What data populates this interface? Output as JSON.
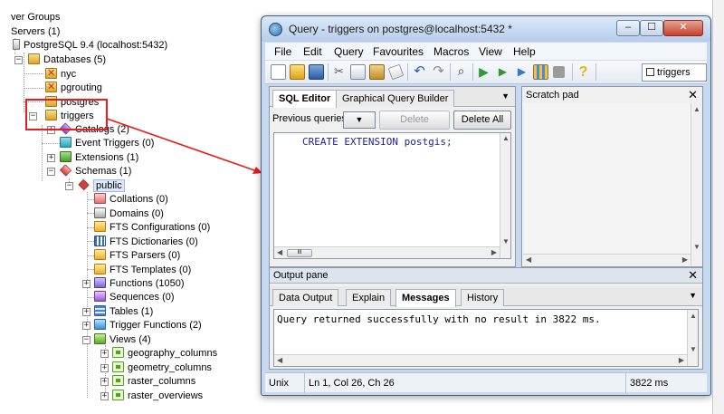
{
  "tree": {
    "items": [
      {
        "label": "ver Groups"
      },
      {
        "label": "Servers (1)"
      },
      {
        "label": "PostgreSQL 9.4 (localhost:5432)"
      },
      {
        "label": "Databases (5)"
      },
      {
        "label": "nyc"
      },
      {
        "label": "pgrouting"
      },
      {
        "label": "postgres"
      },
      {
        "label": "triggers"
      },
      {
        "label": "Catalogs (2)"
      },
      {
        "label": "Event Triggers (0)"
      },
      {
        "label": "Extensions (1)"
      },
      {
        "label": "Schemas (1)"
      },
      {
        "label": "public"
      },
      {
        "label": "Collations (0)"
      },
      {
        "label": "Domains (0)"
      },
      {
        "label": "FTS Configurations (0)"
      },
      {
        "label": "FTS Dictionaries (0)"
      },
      {
        "label": "FTS Parsers (0)"
      },
      {
        "label": "FTS Templates (0)"
      },
      {
        "label": "Functions (1050)"
      },
      {
        "label": "Sequences (0)"
      },
      {
        "label": "Tables (1)"
      },
      {
        "label": "Trigger Functions (2)"
      },
      {
        "label": "Views (4)"
      },
      {
        "label": "geography_columns"
      },
      {
        "label": "geometry_columns"
      },
      {
        "label": "raster_columns"
      },
      {
        "label": "raster_overviews"
      }
    ]
  },
  "window": {
    "title": "Query - triggers on postgres@localhost:5432 *",
    "controls": {
      "minimize": "‒",
      "maximize": "☐",
      "close": "✕"
    }
  },
  "menu": [
    "File",
    "Edit",
    "Query",
    "Favourites",
    "Macros",
    "View",
    "Help"
  ],
  "toolbar": {
    "db_combo": "triggers"
  },
  "editor": {
    "tabs": [
      "SQL Editor",
      "Graphical Query Builder"
    ],
    "active_tab": "SQL Editor",
    "previous_label": "Previous queries",
    "delete_label": "Delete",
    "delete_all_label": "Delete All",
    "sql": "CREATE EXTENSION postgis;",
    "scroll_thumb": "III"
  },
  "scratch": {
    "title": "Scratch pad",
    "close": "✕"
  },
  "output": {
    "title": "Output pane",
    "close": "✕",
    "tabs": [
      "Data Output",
      "Explain",
      "Messages",
      "History"
    ],
    "active_tab": "Messages",
    "message": "Query returned successfully with no result in 3822 ms."
  },
  "status": {
    "mode": "Unix",
    "position": "Ln 1, Col 26, Ch 26",
    "time": "3822 ms"
  },
  "colors": {
    "annotation": "#e51f1f",
    "window_frame": "#c6d9f1",
    "sql_keyword": "#1d1d9c"
  }
}
